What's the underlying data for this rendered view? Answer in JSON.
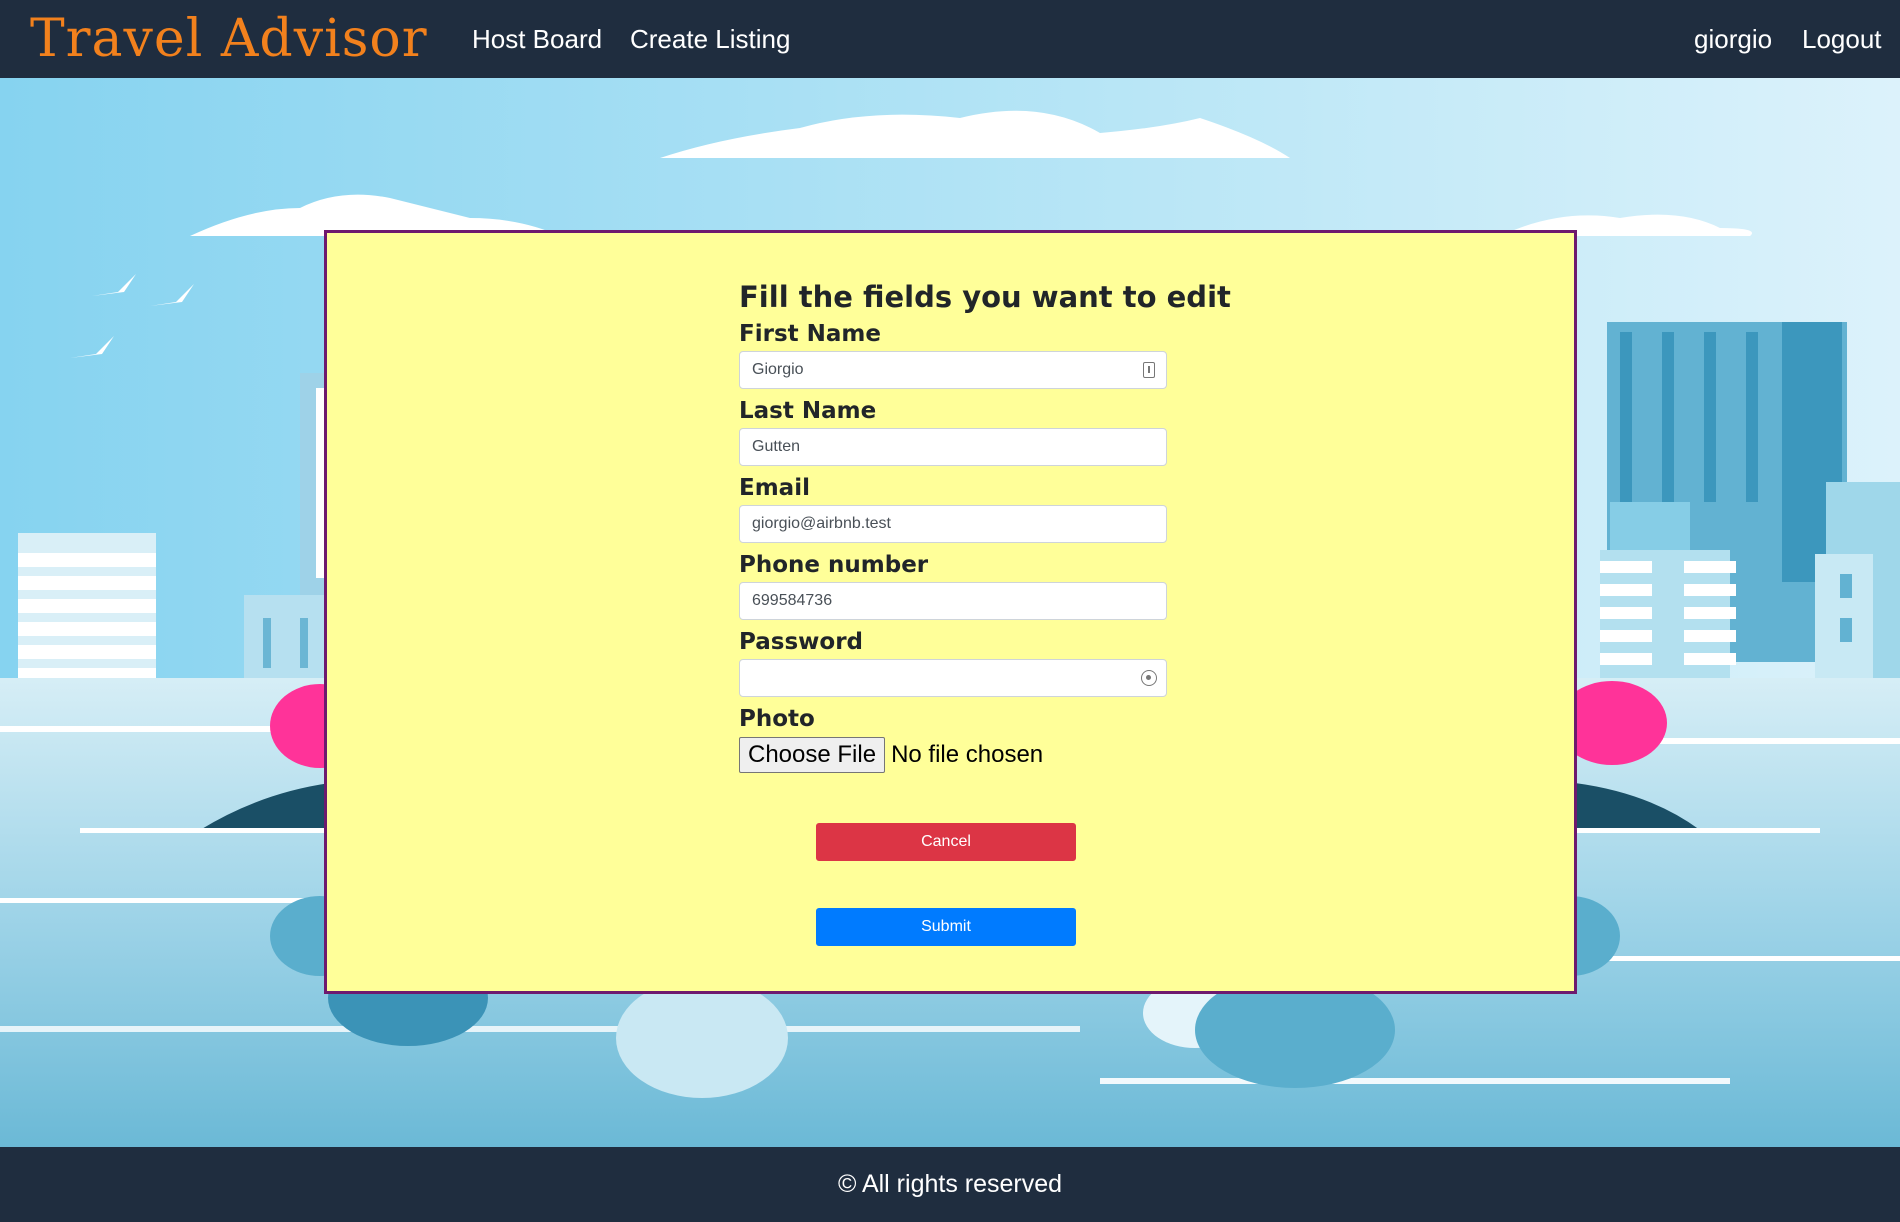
{
  "navbar": {
    "brand": "Travel Advisor",
    "links": [
      "Host Board",
      "Create Listing"
    ],
    "user": "giorgio",
    "logout": "Logout"
  },
  "form": {
    "title": "Fill the fields you want to edit",
    "fields": {
      "first_name": {
        "label": "First Name",
        "value": "Giorgio"
      },
      "last_name": {
        "label": "Last Name",
        "value": "Gutten"
      },
      "email": {
        "label": "Email",
        "value": "giorgio@airbnb.test"
      },
      "phone": {
        "label": "Phone number",
        "value": "699584736"
      },
      "password": {
        "label": "Password",
        "value": ""
      },
      "photo": {
        "label": "Photo",
        "button": "Choose File",
        "status": "No file chosen"
      }
    },
    "cancel_label": "Cancel",
    "submit_label": "Submit"
  },
  "footer": {
    "text": "© All rights reserved"
  },
  "colors": {
    "navbar_bg": "#1f2d3f",
    "brand": "#f2811d",
    "card_bg": "#ffff99",
    "card_border": "#6e1a6e",
    "cancel": "#dc3545",
    "submit": "#007bff"
  }
}
